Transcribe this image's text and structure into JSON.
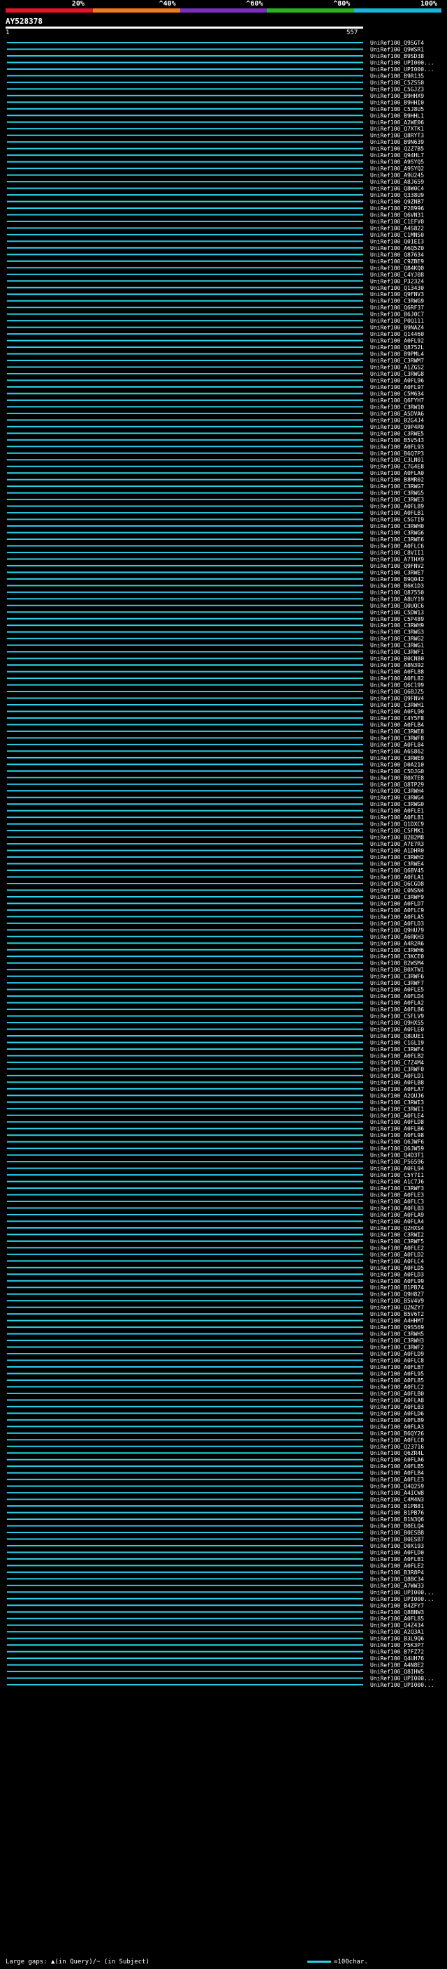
{
  "query_title": "AY528378",
  "scale": {
    "start": "1",
    "end": "557"
  },
  "identity_bar": {
    "colors": [
      "#e6142a",
      "#f07a1c",
      "#7b2fbf",
      "#2ab41e",
      "#1ab6d8"
    ],
    "labels": [
      "20%",
      "^40%",
      "^60%",
      "^80%",
      "100%"
    ]
  },
  "footer": {
    "gaps_text": "Large gaps: ▲(in Query)/~ (in Subject)",
    "legend_text": "=100char."
  },
  "chart_data": {
    "type": "alignment_overview",
    "query_length": 557,
    "hits": [
      "UniRef100_Q9SGT4",
      "UniRef100_Q9WSR1",
      "UniRef100_B9SD38",
      "UniRef100_UPI000...",
      "UniRef100_UPI000...",
      "UniRef100_B9R135",
      "UniRef100_C5ZSS0",
      "UniRef100_C5GJZ3",
      "UniRef100_B9HHX9",
      "UniRef100_B9HHI0",
      "UniRef100_C5J8U5",
      "UniRef100_B9HHL1",
      "UniRef100_A2WE06",
      "UniRef100_Q7XTK1",
      "UniRef100_Q8RYT3",
      "UniRef100_B9N639",
      "UniRef100_Q2Z7B5",
      "UniRef100_Q94HL7",
      "UniRef100_A9SYQ5",
      "UniRef100_A9SYQ2",
      "UniRef100_A9U245",
      "UniRef100_A8J659",
      "UniRef100_Q8W0C4",
      "UniRef100_Q338U9",
      "UniRef100_Q9ZNB7",
      "UniRef100_P28996",
      "UniRef100_Q6VN31",
      "UniRef100_C1EFV0",
      "UniRef100_A4S822",
      "UniRef100_C1MNS0",
      "UniRef100_Q01EI3",
      "UniRef100_A6Q5Z0",
      "UniRef100_Q87634",
      "UniRef100_C9ZBE9",
      "UniRef100_Q84KQ0",
      "UniRef100_C4YJ08",
      "UniRef100_P32324",
      "UniRef100_Q13430",
      "UniRef100_Q9FNV3",
      "UniRef100_C3RWG9",
      "UniRef100_Q6RF37",
      "UniRef100_B6J0C7",
      "UniRef100_P0Q111",
      "UniRef100_B9NAZ4",
      "UniRef100_Q14460",
      "UniRef100_A0FL92",
      "UniRef100_Q8752L",
      "UniRef100_B9PML4",
      "UniRef100_C3RWM7",
      "UniRef100_A1ZGS2",
      "UniRef100_C3RWG8",
      "UniRef100_A0FL96",
      "UniRef100_A0FL97",
      "UniRef100_C5M634",
      "UniRef100_Q6FYH7",
      "UniRef100_C3RW10",
      "UniRef100_A5DVA6",
      "UniRef100_B2G4J4",
      "UniRef100_Q9P4R9",
      "UniRef100_C3RWE5",
      "UniRef100_B5V543",
      "UniRef100_A0FL93",
      "UniRef100_B6Q7P3",
      "UniRef100_C3LN01",
      "UniRef100_C7G4E8",
      "UniRef100_A0FLA0",
      "UniRef100_B8MR02",
      "UniRef100_C3RWG7",
      "UniRef100_C3RWG5",
      "UniRef100_C3RWE3",
      "UniRef100_A0FL89",
      "UniRef100_A0FLB1",
      "UniRef100_C5GTI9",
      "UniRef100_C3RWH0",
      "UniRef100_C3RWG6",
      "UniRef100_C3RWE6",
      "UniRef100_A0FLC6",
      "UniRef100_C8VII1",
      "UniRef100_A7THX9",
      "UniRef100_Q9FNV2",
      "UniRef100_C3RWE7",
      "UniRef100_B9Q042",
      "UniRef100_B6K1D3",
      "UniRef100_Q87550",
      "UniRef100_A8UY19",
      "UniRef100_Q0UQC6",
      "UniRef100_C5DW13",
      "UniRef100_C5P489",
      "UniRef100_C3RWH9",
      "UniRef100_C3RWG3",
      "UniRef100_C3RWG2",
      "UniRef100_C3RWG1",
      "UniRef100_C3RWF1",
      "UniRef100_B0CN80",
      "UniRef100_A8N392",
      "UniRef100_A0FL88",
      "UniRef100_A0FL82",
      "UniRef100_Q6C199",
      "UniRef100_Q6BJZ5",
      "UniRef100_Q9FNV4",
      "UniRef100_C3RWH1",
      "UniRef100_A0FL90",
      "UniRef100_C4Y5F8",
      "UniRef100_A0FLB4",
      "UniRef100_C3RWE8",
      "UniRef100_C3RWF8",
      "UniRef100_A0FL84",
      "UniRef100_A6S862",
      "UniRef100_C3RWE9",
      "UniRef100_D0A210",
      "UniRef100_C5DJG0",
      "UniRef100_B0XTE8",
      "UniRef100_Q8TP29",
      "UniRef100_C3RWH4",
      "UniRef100_C3RWG4",
      "UniRef100_C3RWG0",
      "UniRef100_A0FLE1",
      "UniRef100_A0FL81",
      "UniRef100_Q1DXC9",
      "UniRef100_C5FMK1",
      "UniRef100_B2B2M8",
      "UniRef100_A7E7R3",
      "UniRef100_A1DHR0",
      "UniRef100_C3RWH2",
      "UniRef100_C3RWE4",
      "UniRef100_Q6BV45",
      "UniRef100_A0FLA1",
      "UniRef100_Q6CGD8",
      "UniRef100_C0NSN4",
      "UniRef100_C3RWF9",
      "UniRef100_A0FLD7",
      "UniRef100_A0FLC9",
      "UniRef100_A0FLA5",
      "UniRef100_A0FLD3",
      "UniRef100_Q9HU79",
      "UniRef100_A6RKH3",
      "UniRef100_A4R2R6",
      "UniRef100_C3RWH6",
      "UniRef100_C3KCE0",
      "UniRef100_B2WSM4",
      "UniRef100_B0XTW1",
      "UniRef100_C3RWF6",
      "UniRef100_C3RWF7",
      "UniRef100_A0FLE5",
      "UniRef100_A0FLD4",
      "UniRef100_A0FLA2",
      "UniRef100_A0FL86",
      "UniRef100_C5FLV9",
      "UniRef100_Q9HX55",
      "UniRef100_A0FLE0",
      "UniRef100_Q8UUE1",
      "UniRef100_C1GL19",
      "UniRef100_C3RWF4",
      "UniRef100_A0FLB2",
      "UniRef100_C7Z4M4",
      "UniRef100_C3RWF0",
      "UniRef100_A0FLD1",
      "UniRef100_A0FLB8",
      "UniRef100_A0FLA7",
      "UniRef100_A2QUJ6",
      "UniRef100_C3RWI3",
      "UniRef100_C3RWI1",
      "UniRef100_A0FLE4",
      "UniRef100_A0FLD8",
      "UniRef100_A0FLB6",
      "UniRef100_A0FL98",
      "UniRef100_Q6JWF6",
      "UniRef100_Q6JW59",
      "UniRef100_Q4D3T1",
      "UniRef100_P56596",
      "UniRef100_A0FL94",
      "UniRef100_C5Y7I1",
      "UniRef100_A1C7J6",
      "UniRef100_C3RWF3",
      "UniRef100_A0FLE3",
      "UniRef100_A0FLC3",
      "UniRef100_A0FLB3",
      "UniRef100_A0FLA9",
      "UniRef100_A0FLA4",
      "UniRef100_Q2HXS4",
      "UniRef100_C3RWI2",
      "UniRef100_C3RWF5",
      "UniRef100_A0FLE2",
      "UniRef100_A0FLD2",
      "UniRef100_A0FLC4",
      "UniRef100_A0FLD5",
      "UniRef100_A0FLD3",
      "UniRef100_A0FL99",
      "UniRef100_B1PB74",
      "UniRef100_Q9H827",
      "UniRef100_B5V4V9",
      "UniRef100_Q2NZY7",
      "UniRef100_B5V6T2",
      "UniRef100_A4HHM7",
      "UniRef100_Q9S569",
      "UniRef100_C3RWH5",
      "UniRef100_C3RWH3",
      "UniRef100_C3RWF2",
      "UniRef100_A0FLD9",
      "UniRef100_A0FLC8",
      "UniRef100_A0FLB7",
      "UniRef100_A0FL95",
      "UniRef100_A0FL85",
      "UniRef100_A0FLC2",
      "UniRef100_A0FLB0",
      "UniRef100_A0FLA8",
      "UniRef100_A0FL83",
      "UniRef100_A0FLD6",
      "UniRef100_A0FLB9",
      "UniRef100_A0FLA3",
      "UniRef100_B6QY26",
      "UniRef100_A0FLC0",
      "UniRef100_Q23716",
      "UniRef100_Q6ZR4L",
      "UniRef100_A0FLA6",
      "UniRef100_A0FLB5",
      "UniRef100_A0FLB4",
      "UniRef100_A0FLE3",
      "UniRef100_Q4Q259",
      "UniRef100_A4ICW8",
      "UniRef100_C4M4N3",
      "UniRef100_B1PB81",
      "UniRef100_B1PB76",
      "UniRef100_B1N3Q6",
      "UniRef100_B0ELQ4",
      "UniRef100_B0ESB8",
      "UniRef100_B0ESB7",
      "UniRef100_D0X193",
      "UniRef100_A0FLD0",
      "UniRef100_A0FLB1",
      "UniRef100_A0FLE2",
      "UniRef100_B3R8P4",
      "UniRef100_Q8BC34",
      "UniRef100_A7WW33",
      "UniRef100_UPI000...",
      "UniRef100_UPI000...",
      "UniRef100_B4ZFY7",
      "UniRef100_Q8BNW3",
      "UniRef100_A0FL85",
      "UniRef100_Q4Z434",
      "UniRef100_A2Q3A1",
      "UniRef100_B3L9Q6",
      "UniRef100_P5K3P7",
      "UniRef100_B7FZ72",
      "UniRef100_Q4UH76",
      "UniRef100_A4N8E2",
      "UniRef100_Q8IHW5",
      "UniRef100_UPI000...",
      "UniRef100_UPI000..."
    ]
  }
}
